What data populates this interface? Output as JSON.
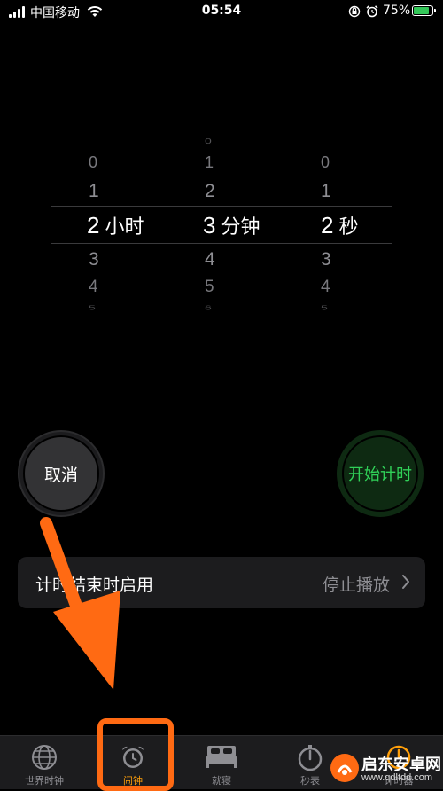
{
  "status": {
    "carrier": "中国移动",
    "time": "05:54",
    "battery_percent": "75%",
    "battery_color": "#34c759"
  },
  "picker": {
    "hours": {
      "above": [
        "0",
        "1"
      ],
      "selected": "2",
      "unit": "小时",
      "below": [
        "3",
        "4",
        "5"
      ]
    },
    "minutes": {
      "above": [
        "0",
        "1",
        "2"
      ],
      "selected": "3",
      "unit": "分钟",
      "below": [
        "4",
        "5",
        "6"
      ]
    },
    "seconds": {
      "above": [
        "0",
        "1"
      ],
      "selected": "2",
      "unit": "秒",
      "below": [
        "3",
        "4",
        "5"
      ]
    }
  },
  "buttons": {
    "cancel": "取消",
    "start": "开始计时",
    "start_color": "#30d158"
  },
  "setting": {
    "label": "计时结束时启用",
    "value": "停止播放"
  },
  "tabs": [
    {
      "label": "世界时钟",
      "icon": "globe-icon"
    },
    {
      "label": "闹钟",
      "icon": "alarm-clock-icon",
      "active": true
    },
    {
      "label": "就寝",
      "icon": "bed-icon"
    },
    {
      "label": "秒表",
      "icon": "stopwatch-icon"
    },
    {
      "label": "计时器",
      "icon": "timer-icon"
    }
  ],
  "watermark": {
    "title": "启东安卓网",
    "url": "www.qdltdd.com"
  },
  "annotation_color": "#ff6a13"
}
